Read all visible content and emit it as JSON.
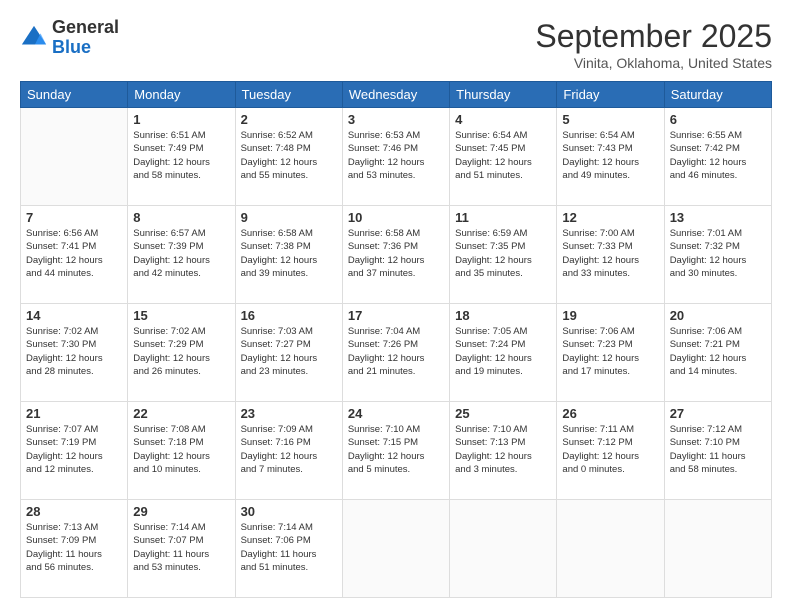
{
  "header": {
    "logo_general": "General",
    "logo_blue": "Blue",
    "month_title": "September 2025",
    "subtitle": "Vinita, Oklahoma, United States"
  },
  "days_of_week": [
    "Sunday",
    "Monday",
    "Tuesday",
    "Wednesday",
    "Thursday",
    "Friday",
    "Saturday"
  ],
  "weeks": [
    [
      {
        "day": "",
        "info": ""
      },
      {
        "day": "1",
        "info": "Sunrise: 6:51 AM\nSunset: 7:49 PM\nDaylight: 12 hours\nand 58 minutes."
      },
      {
        "day": "2",
        "info": "Sunrise: 6:52 AM\nSunset: 7:48 PM\nDaylight: 12 hours\nand 55 minutes."
      },
      {
        "day": "3",
        "info": "Sunrise: 6:53 AM\nSunset: 7:46 PM\nDaylight: 12 hours\nand 53 minutes."
      },
      {
        "day": "4",
        "info": "Sunrise: 6:54 AM\nSunset: 7:45 PM\nDaylight: 12 hours\nand 51 minutes."
      },
      {
        "day": "5",
        "info": "Sunrise: 6:54 AM\nSunset: 7:43 PM\nDaylight: 12 hours\nand 49 minutes."
      },
      {
        "day": "6",
        "info": "Sunrise: 6:55 AM\nSunset: 7:42 PM\nDaylight: 12 hours\nand 46 minutes."
      }
    ],
    [
      {
        "day": "7",
        "info": "Sunrise: 6:56 AM\nSunset: 7:41 PM\nDaylight: 12 hours\nand 44 minutes."
      },
      {
        "day": "8",
        "info": "Sunrise: 6:57 AM\nSunset: 7:39 PM\nDaylight: 12 hours\nand 42 minutes."
      },
      {
        "day": "9",
        "info": "Sunrise: 6:58 AM\nSunset: 7:38 PM\nDaylight: 12 hours\nand 39 minutes."
      },
      {
        "day": "10",
        "info": "Sunrise: 6:58 AM\nSunset: 7:36 PM\nDaylight: 12 hours\nand 37 minutes."
      },
      {
        "day": "11",
        "info": "Sunrise: 6:59 AM\nSunset: 7:35 PM\nDaylight: 12 hours\nand 35 minutes."
      },
      {
        "day": "12",
        "info": "Sunrise: 7:00 AM\nSunset: 7:33 PM\nDaylight: 12 hours\nand 33 minutes."
      },
      {
        "day": "13",
        "info": "Sunrise: 7:01 AM\nSunset: 7:32 PM\nDaylight: 12 hours\nand 30 minutes."
      }
    ],
    [
      {
        "day": "14",
        "info": "Sunrise: 7:02 AM\nSunset: 7:30 PM\nDaylight: 12 hours\nand 28 minutes."
      },
      {
        "day": "15",
        "info": "Sunrise: 7:02 AM\nSunset: 7:29 PM\nDaylight: 12 hours\nand 26 minutes."
      },
      {
        "day": "16",
        "info": "Sunrise: 7:03 AM\nSunset: 7:27 PM\nDaylight: 12 hours\nand 23 minutes."
      },
      {
        "day": "17",
        "info": "Sunrise: 7:04 AM\nSunset: 7:26 PM\nDaylight: 12 hours\nand 21 minutes."
      },
      {
        "day": "18",
        "info": "Sunrise: 7:05 AM\nSunset: 7:24 PM\nDaylight: 12 hours\nand 19 minutes."
      },
      {
        "day": "19",
        "info": "Sunrise: 7:06 AM\nSunset: 7:23 PM\nDaylight: 12 hours\nand 17 minutes."
      },
      {
        "day": "20",
        "info": "Sunrise: 7:06 AM\nSunset: 7:21 PM\nDaylight: 12 hours\nand 14 minutes."
      }
    ],
    [
      {
        "day": "21",
        "info": "Sunrise: 7:07 AM\nSunset: 7:19 PM\nDaylight: 12 hours\nand 12 minutes."
      },
      {
        "day": "22",
        "info": "Sunrise: 7:08 AM\nSunset: 7:18 PM\nDaylight: 12 hours\nand 10 minutes."
      },
      {
        "day": "23",
        "info": "Sunrise: 7:09 AM\nSunset: 7:16 PM\nDaylight: 12 hours\nand 7 minutes."
      },
      {
        "day": "24",
        "info": "Sunrise: 7:10 AM\nSunset: 7:15 PM\nDaylight: 12 hours\nand 5 minutes."
      },
      {
        "day": "25",
        "info": "Sunrise: 7:10 AM\nSunset: 7:13 PM\nDaylight: 12 hours\nand 3 minutes."
      },
      {
        "day": "26",
        "info": "Sunrise: 7:11 AM\nSunset: 7:12 PM\nDaylight: 12 hours\nand 0 minutes."
      },
      {
        "day": "27",
        "info": "Sunrise: 7:12 AM\nSunset: 7:10 PM\nDaylight: 11 hours\nand 58 minutes."
      }
    ],
    [
      {
        "day": "28",
        "info": "Sunrise: 7:13 AM\nSunset: 7:09 PM\nDaylight: 11 hours\nand 56 minutes."
      },
      {
        "day": "29",
        "info": "Sunrise: 7:14 AM\nSunset: 7:07 PM\nDaylight: 11 hours\nand 53 minutes."
      },
      {
        "day": "30",
        "info": "Sunrise: 7:14 AM\nSunset: 7:06 PM\nDaylight: 11 hours\nand 51 minutes."
      },
      {
        "day": "",
        "info": ""
      },
      {
        "day": "",
        "info": ""
      },
      {
        "day": "",
        "info": ""
      },
      {
        "day": "",
        "info": ""
      }
    ]
  ]
}
